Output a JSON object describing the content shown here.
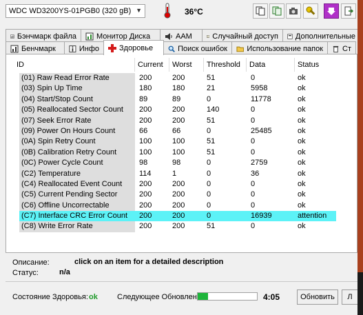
{
  "toolbar": {
    "drive": "WDC WD3200YS-01PGB0 (320 gB)",
    "temperature": "36°C"
  },
  "tabs_row1": [
    {
      "label": "Бэнчмарк файла"
    },
    {
      "label": "Монитор Диска"
    },
    {
      "label": "AAM"
    },
    {
      "label": "Случайный доступ"
    },
    {
      "label": "Дополнительные"
    }
  ],
  "tabs_row2": [
    {
      "label": "Бенчмарк"
    },
    {
      "label": "Инфо"
    },
    {
      "label": "Здоровье",
      "active": true
    },
    {
      "label": "Поиск ошибок"
    },
    {
      "label": "Использование папок"
    },
    {
      "label": "Ст"
    }
  ],
  "table": {
    "headers": [
      "ID",
      "Current",
      "Worst",
      "Threshold",
      "Data",
      "Status"
    ],
    "rows": [
      [
        "(01) Raw Read Error Rate",
        "200",
        "200",
        "51",
        "0",
        "ok"
      ],
      [
        "(03) Spin Up Time",
        "180",
        "180",
        "21",
        "5958",
        "ok"
      ],
      [
        "(04) Start/Stop Count",
        "89",
        "89",
        "0",
        "11778",
        "ok"
      ],
      [
        "(05) Reallocated Sector Count",
        "200",
        "200",
        "140",
        "0",
        "ok"
      ],
      [
        "(07) Seek Error Rate",
        "200",
        "200",
        "51",
        "0",
        "ok"
      ],
      [
        "(09) Power On Hours Count",
        "66",
        "66",
        "0",
        "25485",
        "ok"
      ],
      [
        "(0A) Spin Retry Count",
        "100",
        "100",
        "51",
        "0",
        "ok"
      ],
      [
        "(0B) Calibration Retry Count",
        "100",
        "100",
        "51",
        "0",
        "ok"
      ],
      [
        "(0C) Power Cycle Count",
        "98",
        "98",
        "0",
        "2759",
        "ok"
      ],
      [
        "(C2) Temperature",
        "114",
        "1",
        "0",
        "36",
        "ok"
      ],
      [
        "(C4) Reallocated Event Count",
        "200",
        "200",
        "0",
        "0",
        "ok"
      ],
      [
        "(C5) Current Pending Sector",
        "200",
        "200",
        "0",
        "0",
        "ok"
      ],
      [
        "(C6) Offline Uncorrectable",
        "200",
        "200",
        "0",
        "0",
        "ok"
      ],
      [
        "(C7) Interface CRC Error Count",
        "200",
        "200",
        "0",
        "16939",
        "attention"
      ],
      [
        "(C8) Write Error Rate",
        "200",
        "200",
        "51",
        "0",
        "ok"
      ]
    ],
    "highlight_row": 13,
    "highlight_color": "#5cf2f7"
  },
  "details": {
    "description_label": "Описание:",
    "description_value": "click on an item for a detailed description",
    "status_label": "Статус:",
    "status_value": "n/a"
  },
  "footer": {
    "health_label": "Состояние Здоровья:",
    "health_value": "ok",
    "health_color": "#1f9a2a",
    "next_update_label": "Следующее Обновление:",
    "progress": 0.17,
    "countdown": "4:05",
    "refresh_button": "Обновить",
    "extra_button": "Л"
  }
}
